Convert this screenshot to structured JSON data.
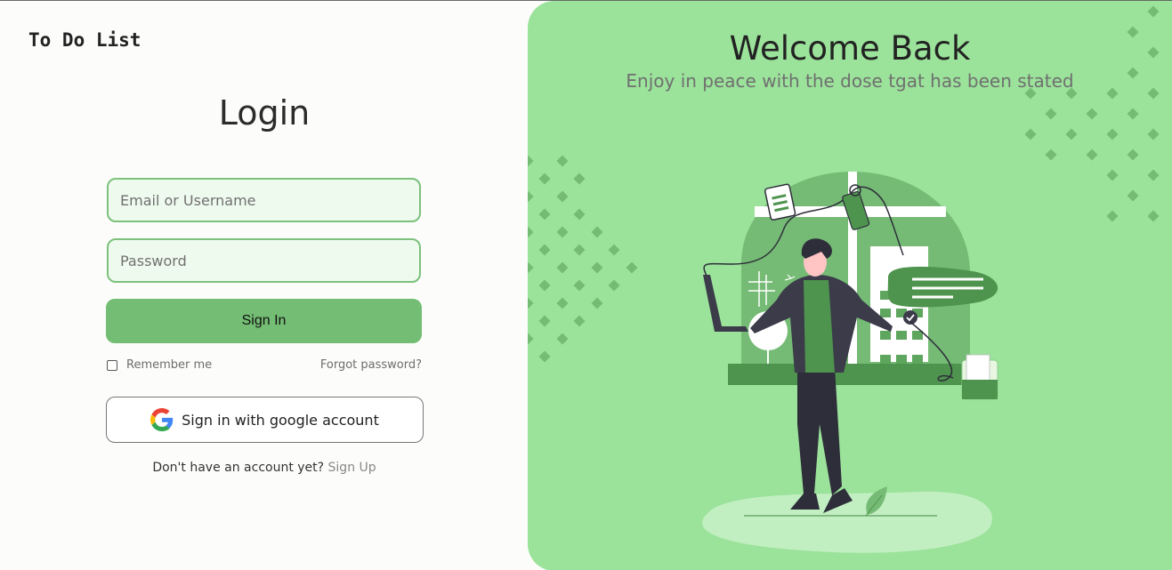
{
  "brand": "To Do List",
  "login": {
    "title": "Login",
    "email_placeholder": "Email or Username",
    "password_placeholder": "Password",
    "signin_label": "Sign In",
    "remember_label": "Remember me",
    "forgot_label": "Forgot password?",
    "google_label": "Sign in with google account",
    "no_account_text": "Don't have an account yet? ",
    "signup_label": "Sign Up"
  },
  "panel": {
    "title": "Welcome Back",
    "subtitle": "Enjoy in peace with the dose tgat has been stated"
  },
  "icons": {
    "google": "google-logo-icon",
    "checkbox": "checkbox-icon"
  },
  "colors": {
    "accent": "#74bd74",
    "panel_bg": "#9be29a",
    "input_bg": "#eefaee",
    "input_border": "#7cc17c"
  }
}
